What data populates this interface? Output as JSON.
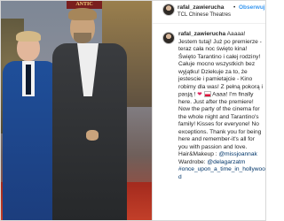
{
  "photo": {
    "sign_text": "ANTIC"
  },
  "post": {
    "username": "rafal_zawierucha",
    "separator": "•",
    "follow_label": "Obserwuj",
    "location": "TCL Chinese Theatres"
  },
  "caption": {
    "username": "rafal_zawierucha",
    "text_part1": "Aaaaa! Jestem tutaj! Już po premierze - teraz cała noc święto kina! Święto Tarantino i całej rodziny! Całuje mocno wszystkich bez wyjątku! Dziekuje za to, że jestescie i pamietajcie - Kino robimy dla was! Z pełną pokorą i pasją ! ",
    "heart": "❤",
    "text_part2": " Aaaa! I'm finally here. Just after the premiere! Now the party of the cinema for the whole night and Tarantino's family! Kisses for everyone! No exceptions. Thank you for being here and remember-it's all for you with passion and love. Hair&Makeup : ",
    "mention1": "@missjoannak",
    "text_part3": " Wardrobe: ",
    "mention2": "@delagarzatm",
    "text_part4": " ",
    "hashtags": "#once_upon_a_time_in_hollywood"
  },
  "colors": {
    "link": "#3897f0",
    "text": "#262626",
    "tag": "#003569"
  }
}
